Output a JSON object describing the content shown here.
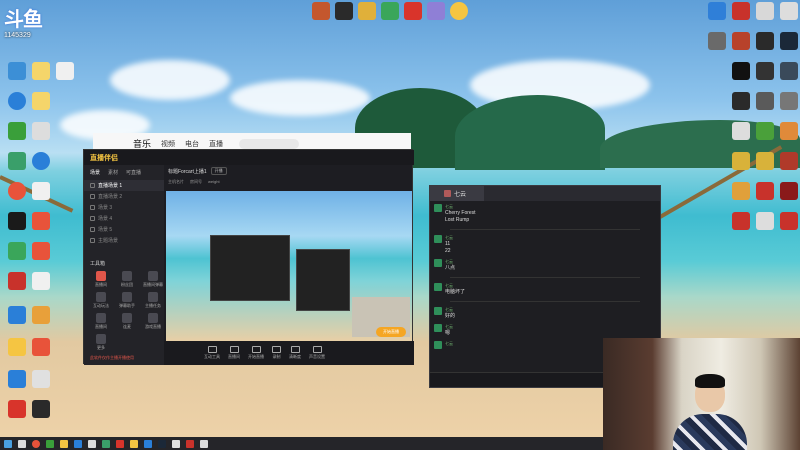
{
  "watermark": {
    "logo_text": "斗鱼",
    "room_id": "1145329"
  },
  "desktop_icons_left": [
    {
      "label": "",
      "icon": "app-icon",
      "color": "#4aa0e0"
    },
    {
      "label": "",
      "icon": "app-icon",
      "color": "#4aa0e0"
    },
    {
      "label": "",
      "icon": "app-icon",
      "color": "#4aa0e0"
    },
    {
      "label": "",
      "icon": "app-icon",
      "color": "#3c8fd6"
    },
    {
      "label": "",
      "icon": "app-icon",
      "color": "#4aa0e0"
    },
    {
      "label": "",
      "icon": "app-icon",
      "color": "#3c8fd6"
    },
    {
      "label": "",
      "icon": "app-icon",
      "color": "#4aa0e0"
    },
    {
      "label": "",
      "icon": "app-icon",
      "color": "#4aa0e0"
    }
  ],
  "music_window": {
    "tabs": [
      "音乐",
      "视频",
      "电台",
      "直播"
    ],
    "active_tab": "音乐"
  },
  "stream_app": {
    "logo": "直播伴侣",
    "side_tabs": [
      "场景",
      "素材",
      "可直播"
    ],
    "scenes": [
      "直播场景 1",
      "直播场景 2",
      "场景 3",
      "场景 4",
      "场景 5",
      "主题场景"
    ],
    "tools_title": "工具箱",
    "tools": [
      "直播间",
      "粉丝团",
      "直播间弹幕",
      "互动玩法",
      "弹幕助手",
      "主播任务",
      "直播间",
      "连麦",
      "游戏直播",
      "更多",
      "",
      ""
    ],
    "notice": "此软件仅作主播开播使用",
    "room_title": "标题Forcart上播1",
    "room_tag": "开播",
    "room_info": [
      "主机名片",
      "房间号",
      "weight"
    ],
    "controls": [
      "互动工具",
      "直播间",
      "开始直播",
      "录制",
      "清晰度",
      "声音设置"
    ],
    "go_live": "开始直播"
  },
  "chat": {
    "tab_title": "七云",
    "messages": [
      {
        "name": "七云",
        "time": "",
        "text": "Cherry Forest\nLost Rump"
      },
      {
        "name": "七云",
        "time": "",
        "text": "11\n22"
      },
      {
        "name": "七云",
        "time": "",
        "text": "八点"
      },
      {
        "name": "七云",
        "time": "",
        "text": "电脑坏了"
      },
      {
        "name": "七云",
        "time": "",
        "text": "好的"
      },
      {
        "name": "七云",
        "time": "",
        "text": "嗯"
      },
      {
        "name": "七云",
        "time": "",
        "text": ""
      }
    ]
  }
}
